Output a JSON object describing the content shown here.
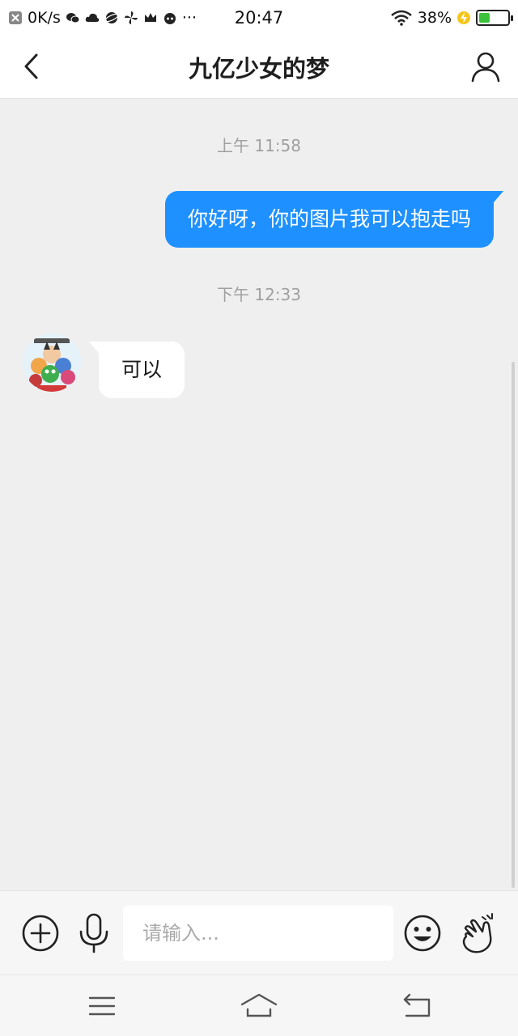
{
  "status_bar": {
    "net_speed": "0K/s",
    "time": "20:47",
    "battery_percent": "38%",
    "battery_level": 0.38,
    "more": "···"
  },
  "header": {
    "title": "九亿少女的梦"
  },
  "chat": {
    "messages": [
      {
        "type": "timestamp",
        "text": "上午 11:58"
      },
      {
        "type": "outgoing",
        "text": "你好呀，你的图片我可以抱走吗"
      },
      {
        "type": "timestamp",
        "text": "下午 12:33"
      },
      {
        "type": "incoming",
        "text": "可以"
      }
    ]
  },
  "input_bar": {
    "placeholder": "请输入..."
  },
  "colors": {
    "accent": "#1e90ff",
    "background": "#efefef",
    "battery": "#3bc23b"
  },
  "icons": {
    "back": "chevron-left-icon",
    "profile": "person-icon",
    "plus": "plus-circle-icon",
    "mic": "microphone-icon",
    "emoji": "smiley-icon",
    "wave": "hand-gesture-icon",
    "nav_menu": "menu-icon",
    "nav_home": "home-icon",
    "nav_back": "return-icon"
  }
}
